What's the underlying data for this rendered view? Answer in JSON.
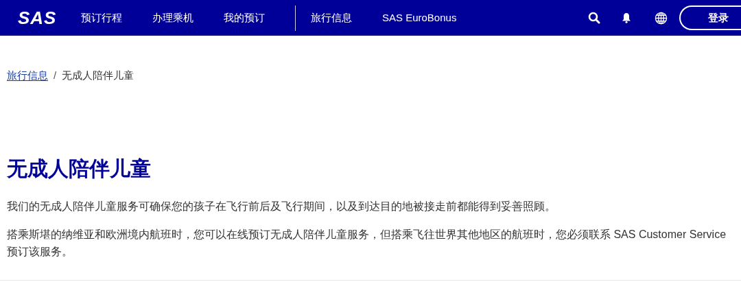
{
  "header": {
    "logo": "SAS",
    "nav": [
      {
        "label": "预订行程",
        "divider_before": false
      },
      {
        "label": "办理乘机",
        "divider_before": false
      },
      {
        "label": "我的预订",
        "divider_before": false
      },
      {
        "label": "旅行信息",
        "divider_before": true
      },
      {
        "label": "SAS EuroBonus",
        "divider_before": false
      }
    ],
    "login": "登录"
  },
  "breadcrumb": [
    {
      "label": "旅行信息",
      "link": true
    },
    {
      "label": "无成人陪伴儿童",
      "link": false
    }
  ],
  "breadcrumb_separator": "/",
  "title": "无成人陪伴儿童",
  "paragraphs": [
    "我们的无成人陪伴儿童服务可确保您的孩子在飞行前后及飞行期间，以及到达目的地被接走前都能得到妥善照顾。",
    "搭乘斯堪的纳维亚和欧洲境内航班时，您可以在线预订无成人陪伴儿童服务，但搭乘飞往世界其他地区的航班时，您必须联系 SAS Customer Service 预订该服务。"
  ]
}
